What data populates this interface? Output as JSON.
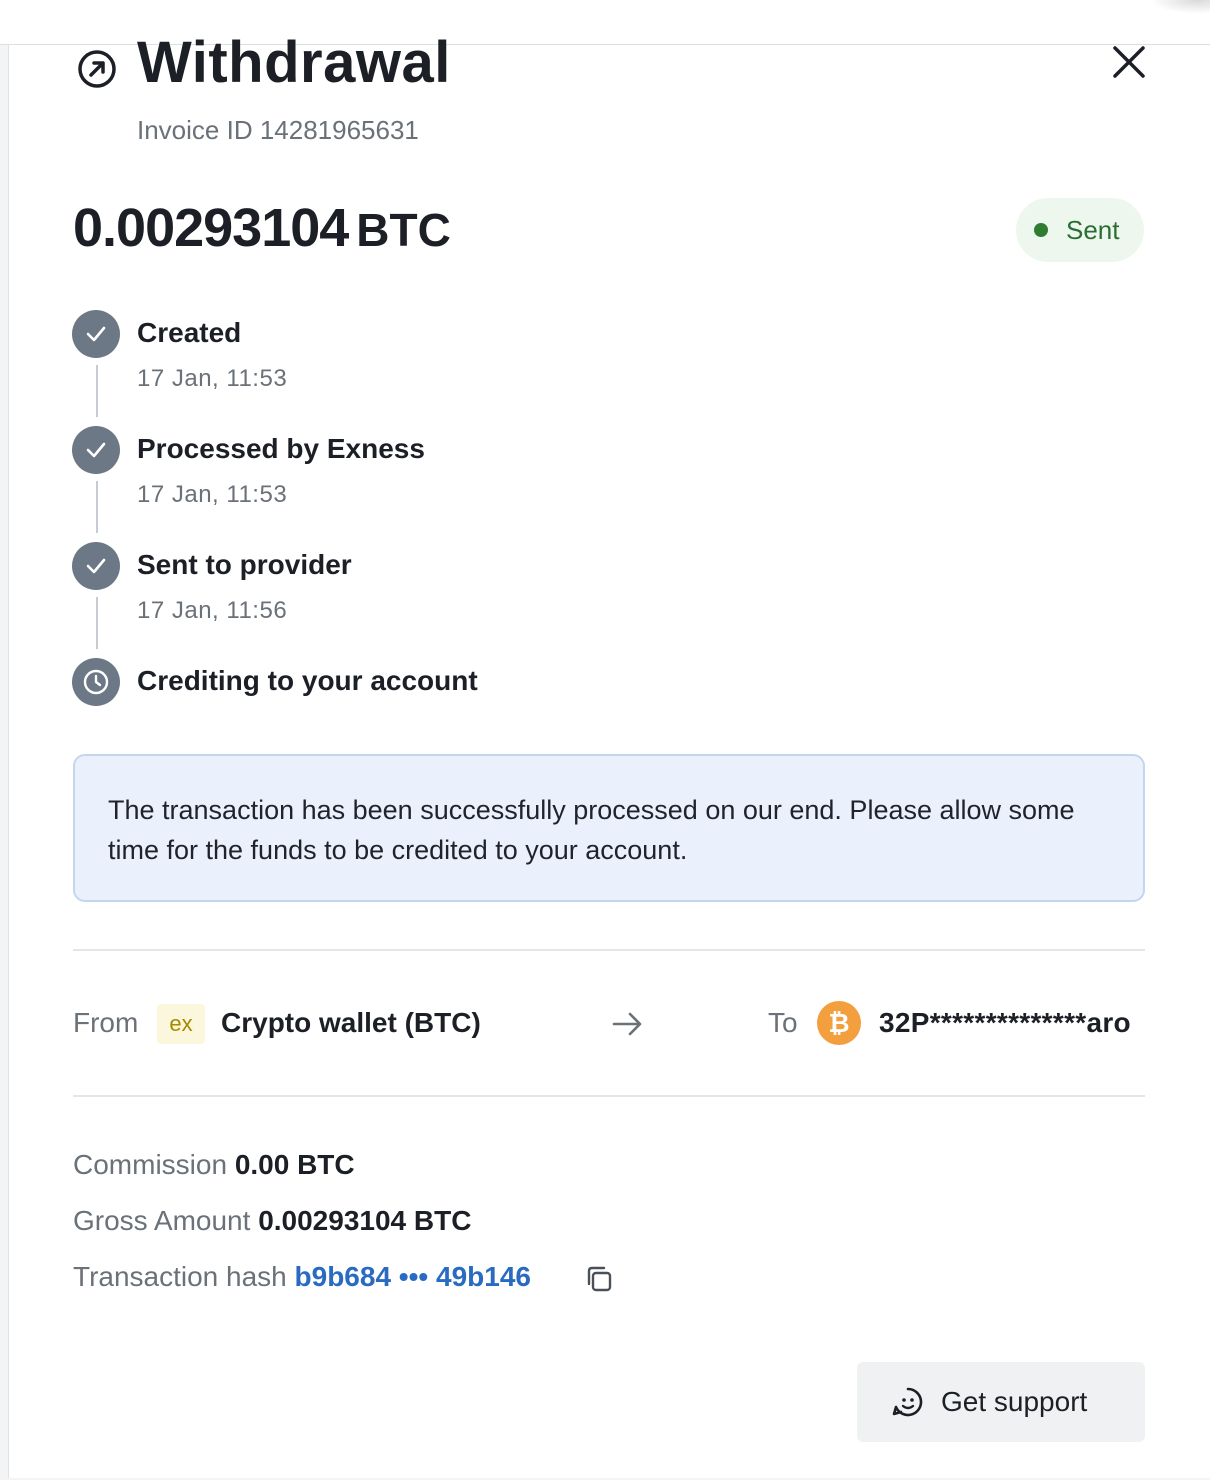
{
  "header": {
    "title": "Withdrawal",
    "invoice": "Invoice ID 14281965631"
  },
  "amount": {
    "value": "0.00293104",
    "currency": "BTC"
  },
  "status": {
    "label": "Sent",
    "color": "#2e7d32"
  },
  "steps": [
    {
      "title": "Created",
      "time": "17 Jan, 11:53",
      "state": "done",
      "icon": "check-icon"
    },
    {
      "title": "Processed by Exness",
      "time": "17 Jan, 11:53",
      "state": "done",
      "icon": "check-icon"
    },
    {
      "title": "Sent to provider",
      "time": "17 Jan, 11:56",
      "state": "done",
      "icon": "check-icon"
    },
    {
      "title": "Crediting to your account",
      "time": "",
      "state": "pending",
      "icon": "clock-icon"
    }
  ],
  "info": {
    "message": "The transaction has been successfully processed on our end. Please allow some time for the funds to be credited to your account."
  },
  "transfer": {
    "from_label": "From",
    "from_logo": "ex",
    "from_value": "Crypto wallet (BTC)",
    "to_label": "To",
    "to_logo": "₿",
    "to_value": "32P**************aro"
  },
  "details": {
    "commission_label": "Commission",
    "commission_value": "0.00 BTC",
    "gross_label": "Gross Amount",
    "gross_value": "0.00293104 BTC",
    "hash_label": "Transaction hash",
    "hash_value": "b9b684 ••• 49b146"
  },
  "support": {
    "label": "Get support"
  },
  "colors": {
    "accent_link": "#2a6bc1",
    "info_bg": "#eaf1fc",
    "step_icon": "#6c7886",
    "btc": "#f39f3e"
  }
}
